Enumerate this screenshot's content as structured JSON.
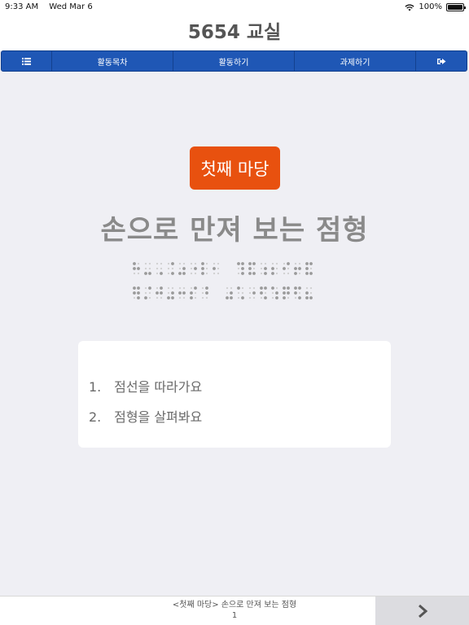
{
  "status_bar": {
    "time": "9:33 AM",
    "date": "Wed Mar 6",
    "battery": "100%",
    "battery_level": 1.0
  },
  "header": {
    "title": "5654 교실"
  },
  "nav": {
    "menu_icon": "list-icon",
    "toc_label": "활동목차",
    "activity_label": "활동하기",
    "task_label": "과제하기",
    "exit_icon": "sign-out-icon"
  },
  "lesson": {
    "badge": "첫째 마당",
    "title": "손으로 만져 보는 점형"
  },
  "items": [
    {
      "number": "1.",
      "text": "점선을 따라가요"
    },
    {
      "number": "2.",
      "text": "점형을 살펴봐요"
    }
  ],
  "footer": {
    "breadcrumb": "<첫째 마당> 손으로 만져 보는 점형",
    "page": "1",
    "next_icon": "chevron-right-icon"
  },
  "colors": {
    "nav_bg": "#1f57b5",
    "badge_bg": "#e8510f",
    "page_bg": "#efeff4"
  }
}
